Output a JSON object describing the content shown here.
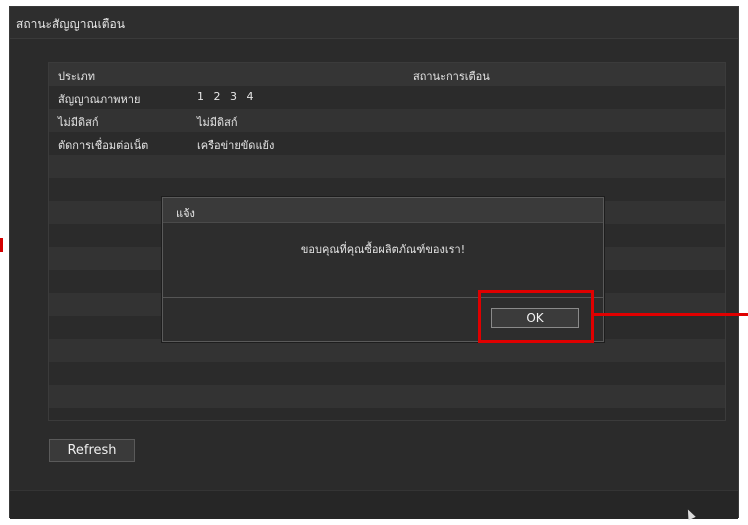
{
  "window": {
    "title": "สถานะสัญญาณเตือน"
  },
  "table": {
    "headers": {
      "type": "ประเภท",
      "status": "สถานะการเตือน"
    },
    "rows": [
      {
        "type": "สัญญาณภาพหาย",
        "channels": [
          "1",
          "2",
          "3",
          "4"
        ]
      },
      {
        "type": "ไม่มีดิสก์",
        "status": "ไม่มีดิสก์"
      },
      {
        "type": "ตัดการเชื่อมต่อเน็ต",
        "status": "เครือข่ายขัดแย้ง"
      }
    ]
  },
  "buttons": {
    "refresh": "Refresh"
  },
  "dialog": {
    "title": "แจ้ง",
    "message": "ขอบคุณที่คุณซื้อผลิตภัณฑ์ของเรา!",
    "ok": "OK"
  },
  "colors": {
    "annotation_red": "#e00000",
    "window_bg": "#2b2b2b",
    "text": "#e6e6e6"
  },
  "icons": {
    "cursor": "mouse-cursor-icon"
  }
}
